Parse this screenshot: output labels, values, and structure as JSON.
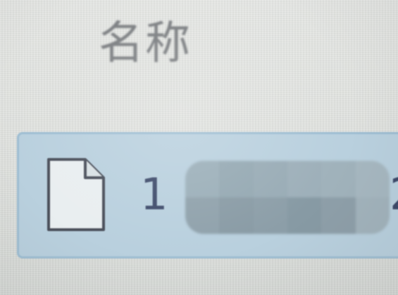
{
  "column_header": {
    "name_label": "名称"
  },
  "file_row": {
    "icon": "document-icon",
    "name_visible_prefix": "1",
    "name_partial_trailing_char": "2",
    "name_obscured": true,
    "selected": true
  },
  "colors": {
    "background": "#e2e4e1",
    "header_text": "#7a7d80",
    "selection_fill": "#b9d0de",
    "selection_border": "#9dbdd2",
    "file_name_text": "#3d4a6a"
  }
}
